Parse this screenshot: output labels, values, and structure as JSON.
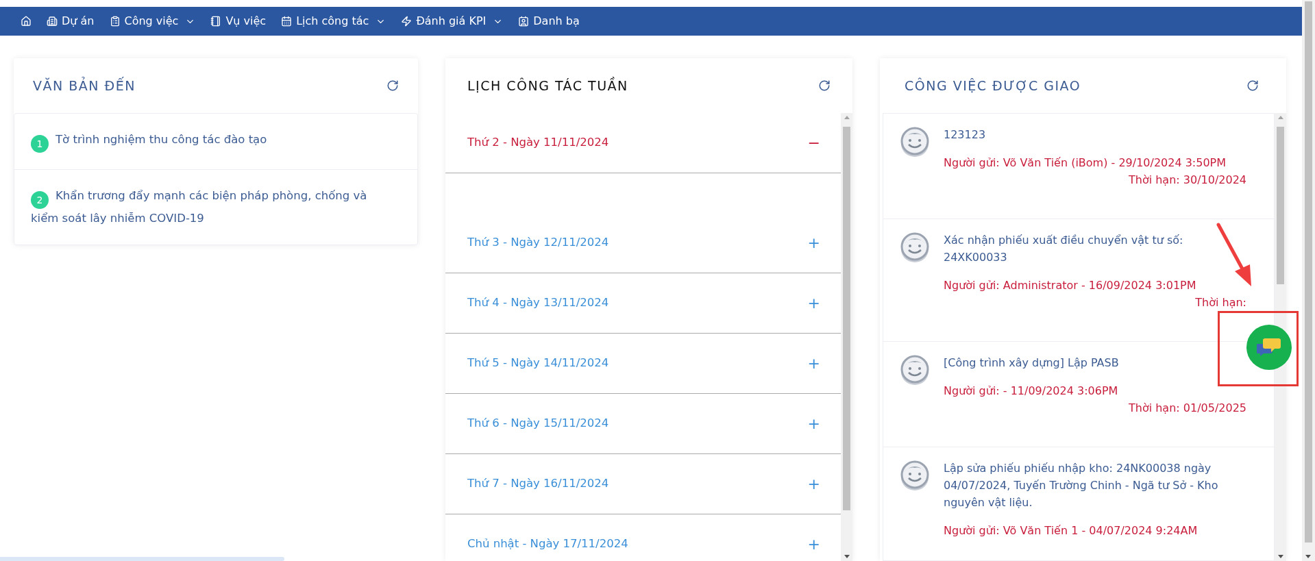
{
  "nav": {
    "items": [
      {
        "dropdown": false
      },
      {
        "label": "Dự án",
        "dropdown": false
      },
      {
        "label": "Công việc",
        "dropdown": true
      },
      {
        "label": "Vụ việc",
        "dropdown": false
      },
      {
        "label": "Lịch công tác",
        "dropdown": true
      },
      {
        "label": "Đánh giá KPI",
        "dropdown": true
      },
      {
        "label": "Danh bạ",
        "dropdown": false
      }
    ]
  },
  "incoming_documents": {
    "title": "VĂN BẢN ĐẾN",
    "items": [
      {
        "number": "1",
        "text": "Tờ trình nghiệm thu công tác đào tạo"
      },
      {
        "number": "2",
        "text": "Khẩn trương đẩy mạnh các biện pháp phòng, chống và kiểm soát lây nhiễm COVID-19"
      }
    ]
  },
  "weekly_schedule": {
    "title": "LỊCH CÔNG TÁC TUẦN",
    "days": [
      {
        "label": "Thứ 2 - Ngày 11/11/2024",
        "expanded": true,
        "toggle": "−"
      },
      {
        "label": "Thứ 3 - Ngày 12/11/2024",
        "expanded": false,
        "toggle": "+"
      },
      {
        "label": "Thứ 4 - Ngày 13/11/2024",
        "expanded": false,
        "toggle": "+"
      },
      {
        "label": "Thứ 5 - Ngày 14/11/2024",
        "expanded": false,
        "toggle": "+"
      },
      {
        "label": "Thứ 6 - Ngày 15/11/2024",
        "expanded": false,
        "toggle": "+"
      },
      {
        "label": "Thứ 7 - Ngày 16/11/2024",
        "expanded": false,
        "toggle": "+"
      },
      {
        "label": "Chủ nhật - Ngày 17/11/2024",
        "expanded": false,
        "toggle": "+"
      }
    ]
  },
  "assigned_tasks": {
    "title": "CÔNG VIỆC ĐƯỢC GIAO",
    "tasks": [
      {
        "title": "123123",
        "sender": "Người gửi: Võ Văn Tiến (iBom) - 29/10/2024 3:50PM",
        "deadline": "Thời hạn: 30/10/2024"
      },
      {
        "title": "Xác nhận phiếu xuất điều chuyển vật tư số: 24XK00033",
        "sender": "Người gửi: Administrator - 16/09/2024 3:01PM",
        "deadline": "Thời hạn:"
      },
      {
        "title": "[Công trình xây dựng] Lập PASB",
        "sender": "Người gửi: - 11/09/2024 3:06PM",
        "deadline": "Thời hạn: 01/05/2025"
      },
      {
        "title": "Lập sửa phiếu phiếu nhập kho: 24NK00038 ngày 04/07/2024, Tuyến Trường Chinh - Ngã tư Sở - Kho nguyên vật liệu.",
        "sender": "Người gửi: Võ Văn Tiến 1 - 04/07/2024 9:24AM"
      }
    ]
  }
}
